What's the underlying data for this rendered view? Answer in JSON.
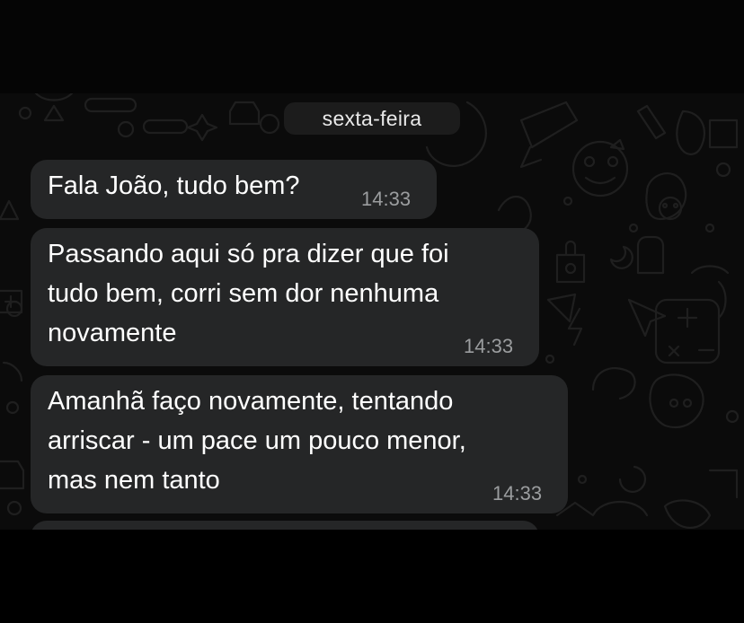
{
  "chat": {
    "date_label": "sexta-feira",
    "messages": [
      {
        "text": "Fala João, tudo bem?",
        "time": "14:33"
      },
      {
        "text": "Passando aqui só pra dizer que foi\ntudo bem, corri sem dor nenhuma\nnovamente",
        "time": "14:33"
      },
      {
        "text": "Amanhã faço novamente, tentando\narriscar - um pace um pouco menor,\nmas nem tanto",
        "time": "14:33"
      }
    ]
  },
  "colors": {
    "background": "#0b0b0b",
    "bubble": "#252627",
    "text": "#ffffff",
    "timestamp": "#9b9d9f",
    "date_chip": "#1c1c1c"
  }
}
